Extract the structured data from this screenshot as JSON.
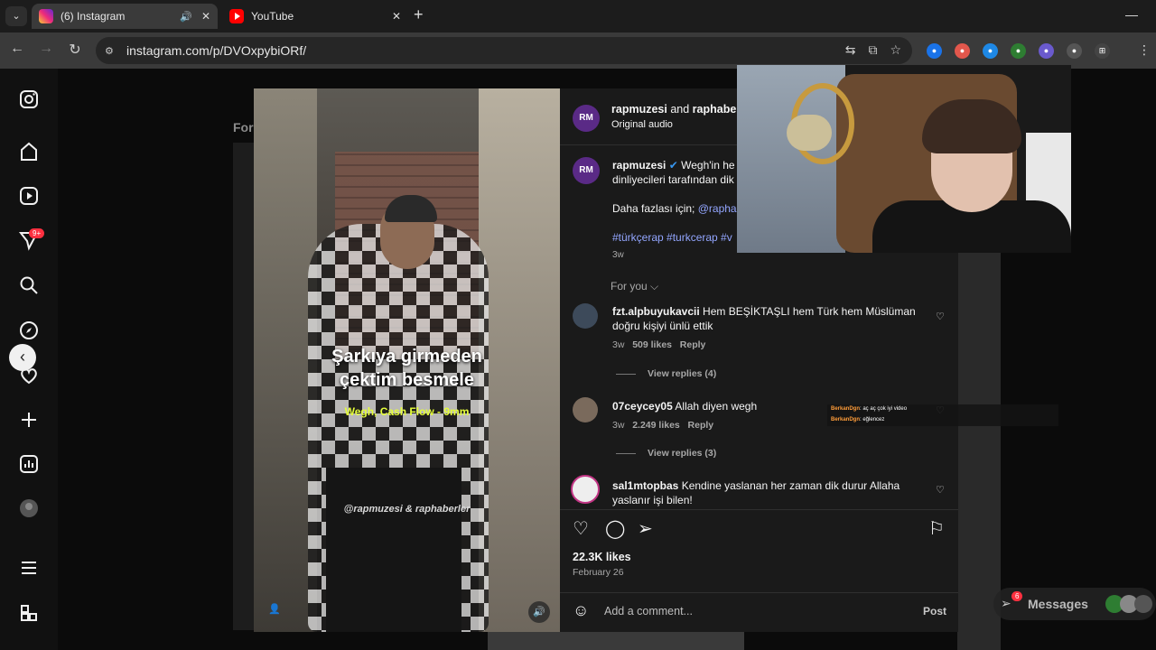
{
  "browser": {
    "tabs": [
      {
        "title": "(6) Instagram",
        "active": true
      },
      {
        "title": "YouTube",
        "active": false
      }
    ],
    "url": "instagram.com/p/DVOxpybiORf/"
  },
  "feed": {
    "for_you_partial": "For"
  },
  "sidebar": {
    "notification_badge": "9+"
  },
  "video": {
    "caption_line1": "Şarkıya girmeden",
    "caption_line2": "çektim besmele",
    "song": "Wegh, Cash Flow - 9mm",
    "credit": "@rapmuzesi & raphaberler"
  },
  "post": {
    "header_user1": "rapmuzesi",
    "header_and": "and",
    "header_user2": "raphaberl",
    "audio": "Original audio",
    "caption_user": "rapmuzesi",
    "caption_text_1": "Wegh'in he",
    "caption_text_2": "dinliyecileri tarafından dik",
    "caption_more": "Daha fazlası için;",
    "caption_mention": "@rapha",
    "caption_tags": "#türkçerap #turkcerap #v",
    "caption_time": "3w",
    "sort_label": "For you",
    "likes": "22.3K likes",
    "date": "February 26",
    "comment_placeholder": "Add a comment...",
    "post_button": "Post"
  },
  "comments": [
    {
      "user": "fzt.alpbuyukavcii",
      "text_1": "Hem BEŞİKTAŞLI hem Türk hem Müslüman",
      "text_2": "doğru kişiyi ünlü ettik",
      "time": "3w",
      "likes": "509 likes",
      "reply": "Reply",
      "view_replies": "View replies (4)"
    },
    {
      "user": "07ceycey05",
      "text_1": "Allah diyen wegh",
      "time": "3w",
      "likes": "2.249 likes",
      "reply": "Reply",
      "view_replies": "View replies (3)"
    },
    {
      "user": "sal1mtopbas",
      "text_1": "Kendine yaslanan her zaman dik durur Allaha",
      "text_2": "yaslanır işi bilen!"
    }
  ],
  "chat": [
    {
      "user": "BerkanDgn",
      "text": ": aç aç çok iyi video"
    },
    {
      "user": "BerkanDgn",
      "text": ": eğlencez"
    }
  ],
  "messages": {
    "label": "Messages",
    "badge": "6"
  },
  "colors": {
    "accent_link": "#93a6ff",
    "badge_red": "#ff3040",
    "song_yellow": "#e6ff3a"
  }
}
